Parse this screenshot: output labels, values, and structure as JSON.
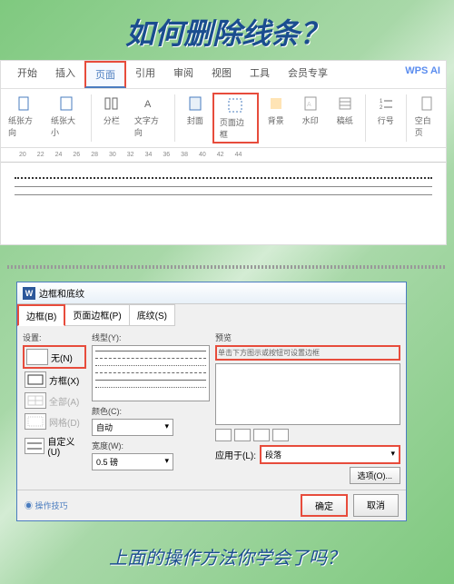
{
  "title": "如何删除线条？",
  "footer": "上面的操作方法你学会了吗？",
  "tabs": {
    "start": "开始",
    "insert": "插入",
    "page": "页面",
    "ref": "引用",
    "review": "审阅",
    "view": "视图",
    "tools": "工具",
    "member": "会员专享",
    "ai": "WPS AI"
  },
  "toolbar": {
    "orient": "纸张方向",
    "size": "纸张大小",
    "columns": "分栏",
    "textdir": "文字方向",
    "cover": "封面",
    "border": "页面边框",
    "bg": "背景",
    "watermark": "水印",
    "manuscript": "稿纸",
    "lineno": "行号",
    "blank": "空白页"
  },
  "ruler": [
    "20",
    "22",
    "24",
    "26",
    "28",
    "30",
    "32",
    "34",
    "36",
    "38",
    "40",
    "42",
    "44"
  ],
  "dialog": {
    "title": "边框和底纹",
    "tabs": {
      "border": "边框(B)",
      "page": "页面边框(P)",
      "shading": "底纹(S)"
    },
    "setting": {
      "label": "设置:",
      "none": "无(N)",
      "box": "方框(X)",
      "all": "全部(A)",
      "grid": "网格(D)",
      "custom": "自定义(U)"
    },
    "style": {
      "label": "线型(Y):",
      "color": "颜色(C):",
      "auto": "自动",
      "width": "宽度(W):",
      "wval": "0.5 磅"
    },
    "preview": {
      "label": "预览",
      "hint": "单击下方图示或按钮可设置边框",
      "apply": "应用于(L):",
      "para": "段落",
      "options": "选项(O)..."
    },
    "tips": "操作技巧",
    "ok": "确定",
    "cancel": "取消"
  }
}
